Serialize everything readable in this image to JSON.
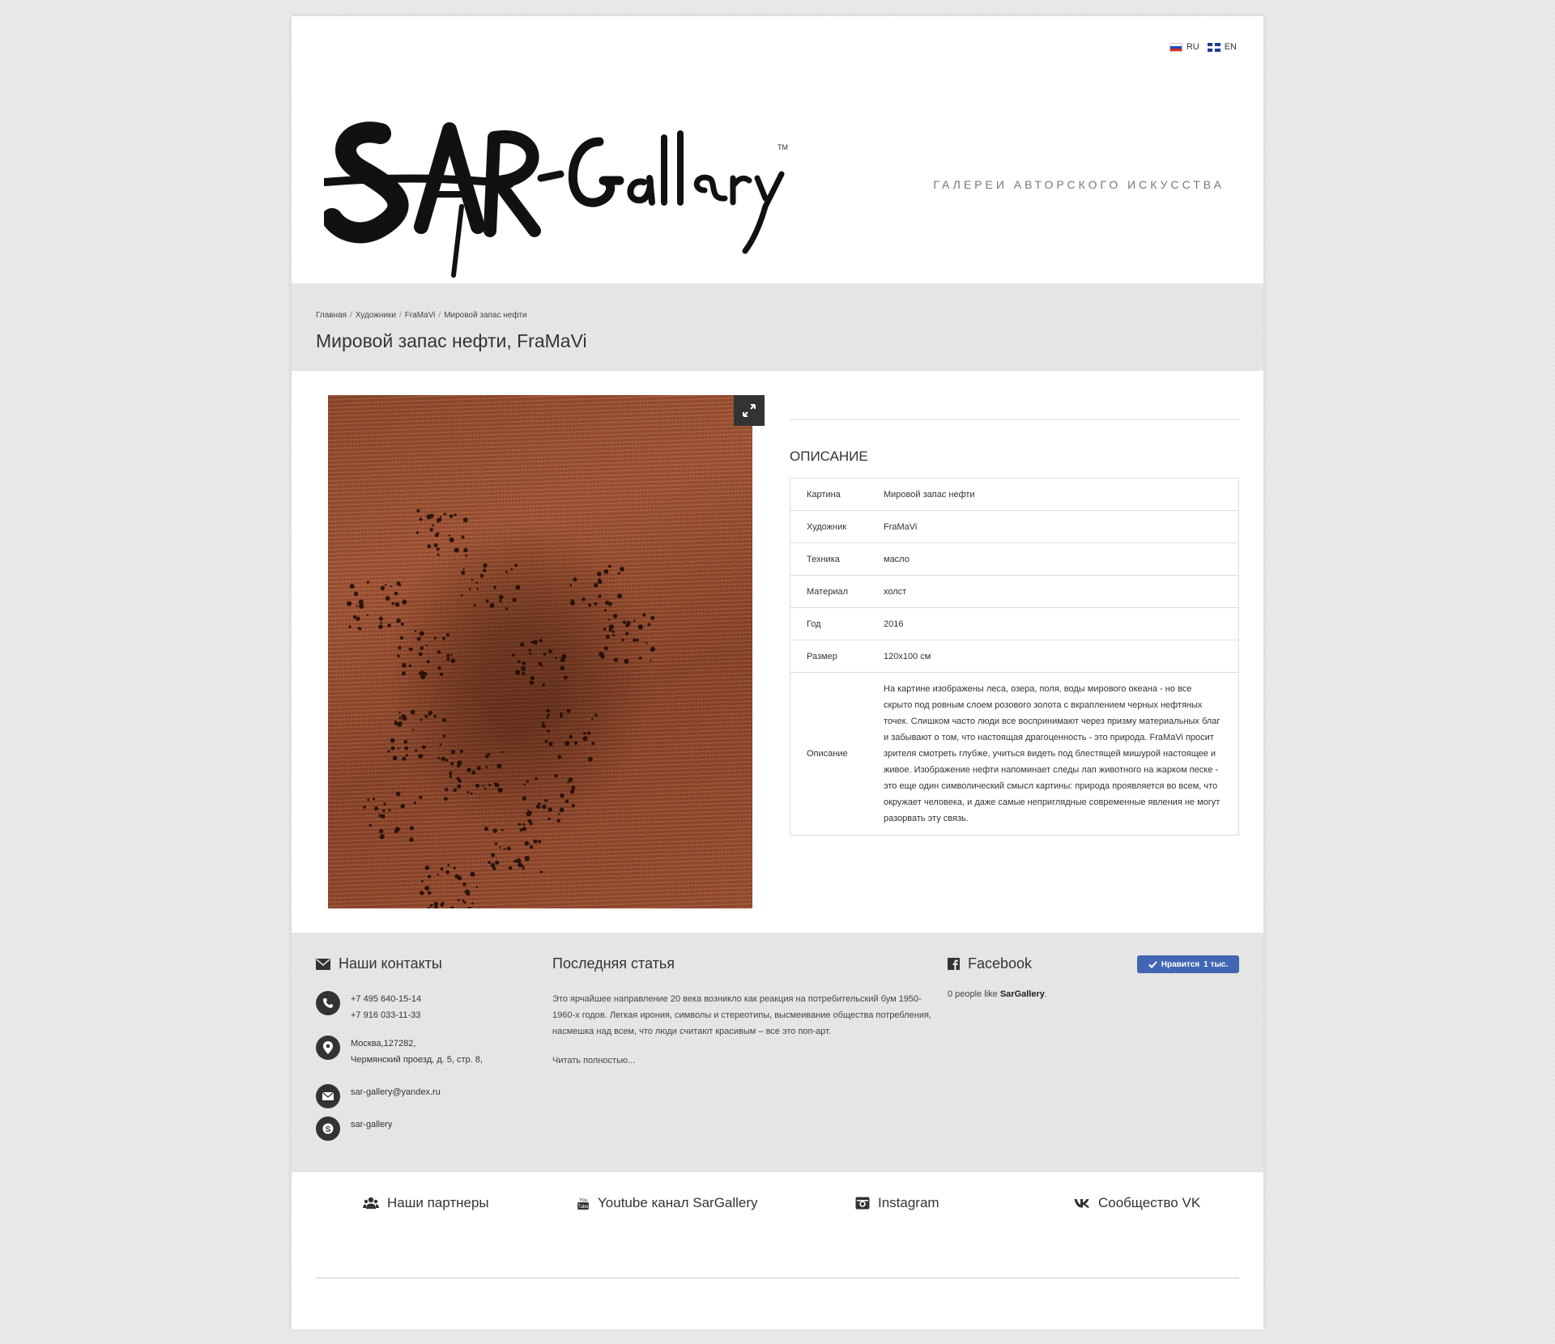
{
  "header": {
    "lang_ru": "RU",
    "lang_en": "EN",
    "logo_text": "SAR-Gallery",
    "logo_tm": "TM",
    "tagline": "ГАЛЕРЕИ АВТОРСКОГО ИСКУССТВА"
  },
  "breadcrumb": [
    "Главная",
    "Художники",
    "FraMaVi",
    "Мировой запас нефти"
  ],
  "page_title": "Мировой запас нефти, FraMaVi",
  "description": {
    "heading": "ОПИСАНИЕ",
    "rows": [
      {
        "key": "Картина",
        "value": "Мировой запас нефти"
      },
      {
        "key": "Художник",
        "value": "FraMaVi"
      },
      {
        "key": "Техника",
        "value": "масло"
      },
      {
        "key": "Материал",
        "value": "холст"
      },
      {
        "key": "Год",
        "value": "2016"
      },
      {
        "key": "Размер",
        "value": "120х100 см"
      },
      {
        "key": "Описание",
        "value": "На картине изображены леса, озера, поля, воды мирового океана - но все скрыто под ровным слоем розового золота с вкраплением черных нефтяных точек. Слишком часто люди все воспринимают через призму материальных благ и забывают о том, что настоящая драгоценность - это природа. FraMaVi просит зрителя смотреть глубже, учиться видеть под блестящей мишурой настоящее и живое. Изображение нефти напоминает следы лап животного на жарком песке - это еще один символический смысл картины: природа проявляется во всем, что окружает человека, и даже самые неприглядные современные явления не могут разорвать эту связь."
      }
    ]
  },
  "contacts": {
    "heading": "Наши контакты",
    "phone1": "+7 495 640-15-14",
    "phone2": "+7 916 033-11-33",
    "address1": "Москва,127282,",
    "address2": "Чермянский проезд, д. 5, стр. 8,",
    "email": "sar-gallery@yandex.ru",
    "skype": "sar-gallery"
  },
  "article": {
    "heading": "Последняя статья",
    "text": "Это ярчайшее направление 20 века возникло как реакция на потребительский бум 1950-1960-х годов. Легкая ирония, символы и стереотипы, высмеивание общества потребления, насмешка над всем, что люди считают красивым – все это поп-арт.",
    "read_more": "Читать полностью..."
  },
  "facebook": {
    "heading": "Facebook",
    "like_label": "Нравится",
    "like_count": "1 тыс.",
    "people_text": "0 people like ",
    "page_name": "SarGallery",
    "period": "."
  },
  "bottom_links": {
    "partners": "Наши партнеры",
    "youtube": "Youtube канал SarGallery",
    "instagram": "Instagram",
    "vk": "Сообщество VK"
  },
  "colors": {
    "background": "#e8e8e6",
    "band": "#e5e5e3",
    "facebook_blue": "#4267b2",
    "painting_copper": "#9c5033"
  }
}
